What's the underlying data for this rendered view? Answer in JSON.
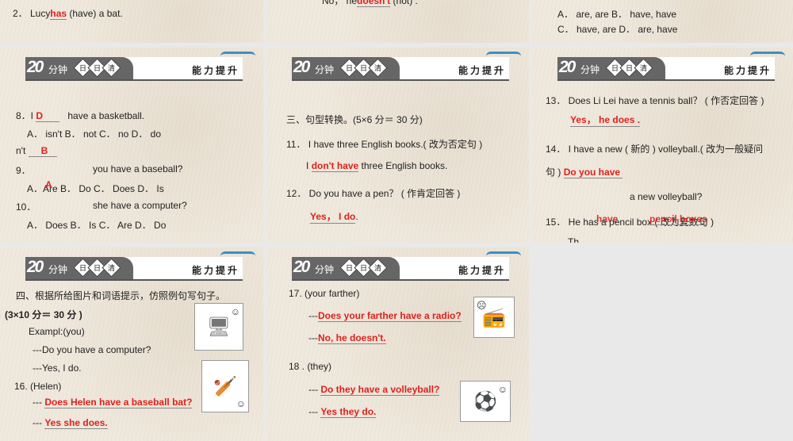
{
  "header": {
    "num": "20",
    "minutes": "分钟",
    "daily": [
      "日",
      "日",
      "清"
    ],
    "section": "能力提升"
  },
  "top": {
    "s1": {
      "q2_pre": "2． Lucy",
      "q2_ans": "has",
      "q2_post": " (have) a bat."
    },
    "s2": {
      "line": "No， he",
      "ans": "doesn't",
      "post": " (not) ."
    },
    "s3": {
      "opt1": "A． are, are  B． have, have",
      "opt2": "C． have, are  D． are, have"
    }
  },
  "mid1": {
    "q8_pre": "8．I",
    "q8_ans": "D",
    "q8_post": "have a basketball.",
    "q8_opts": "A． isn't        B． not        C． no        D． do",
    "q8_wrap": "n't",
    "q9_ans": "B",
    "q9": "9．",
    "q9_text": "you have a baseball?",
    "q9_opts": "A．Are B． Do C． Does D． Is",
    "q10_ans": "A",
    "q10": "10．",
    "q10_text": "she have a computer?",
    "q10_opts": "A． Does B． Is C． Are D． Do"
  },
  "mid2": {
    "section": "三、句型转换。(5×6 分＝ 30 分)",
    "q11": "11． I have three English books.( 改为否定句 )",
    "q11_pre": "I",
    "q11_ans": "don't have",
    "q11_post": " three English books.",
    "q12": "12． Do you have a pen？ ( 作肯定回答 )",
    "q12_ans": "Yes， I do",
    "q12_post": "."
  },
  "mid3": {
    "q13": "13． Does Li Lei have a tennis ball？ ( 作否定回答 )",
    "q13_ans": "Yes， he does .",
    "q14": "14． I have a new ( 新的 ) volleyball.( 改为一般疑问",
    "q14_wrap": "句 )",
    "q14_ans": "Do you have",
    "q14_cont": "a new volleyball?",
    "q15": "15． He has a pencil box.( 改为复数句 )",
    "q15_ans1": "have",
    "q15_ans2": "pencil boxes",
    "q15_next": "Th"
  },
  "bot1": {
    "section": "四、根据所给图片和词语提示，仿照例句写句子。",
    "score": "(3×10 分＝ 30 分 )",
    "example": "Exampl:(you)",
    "ex_q": "---Do  you  have a computer?",
    "ex_a": "---Yes, I do.",
    "q16": "16. (Helen)",
    "dash": "---",
    "q16_q": "Does Helen have a baseball bat?",
    "q16_a": "Yes she does.",
    "pic1": "computer",
    "pic2": "baseball bat"
  },
  "bot2": {
    "q17": "17. (your farther)",
    "dash": "---",
    "q17_q": "Does your farther have a radio?",
    "q17_a": "No, he doesn't.",
    "q18": "18 . (they)",
    "q18_q": "Do they have a volleyball?",
    "q18_a": "Yes they do.",
    "pic1": "radio",
    "pic2": "volleyball"
  },
  "colors": {
    "answer": "#e0201c",
    "slide_bg": "#efe8dc",
    "gap": "#e9e9e9"
  }
}
